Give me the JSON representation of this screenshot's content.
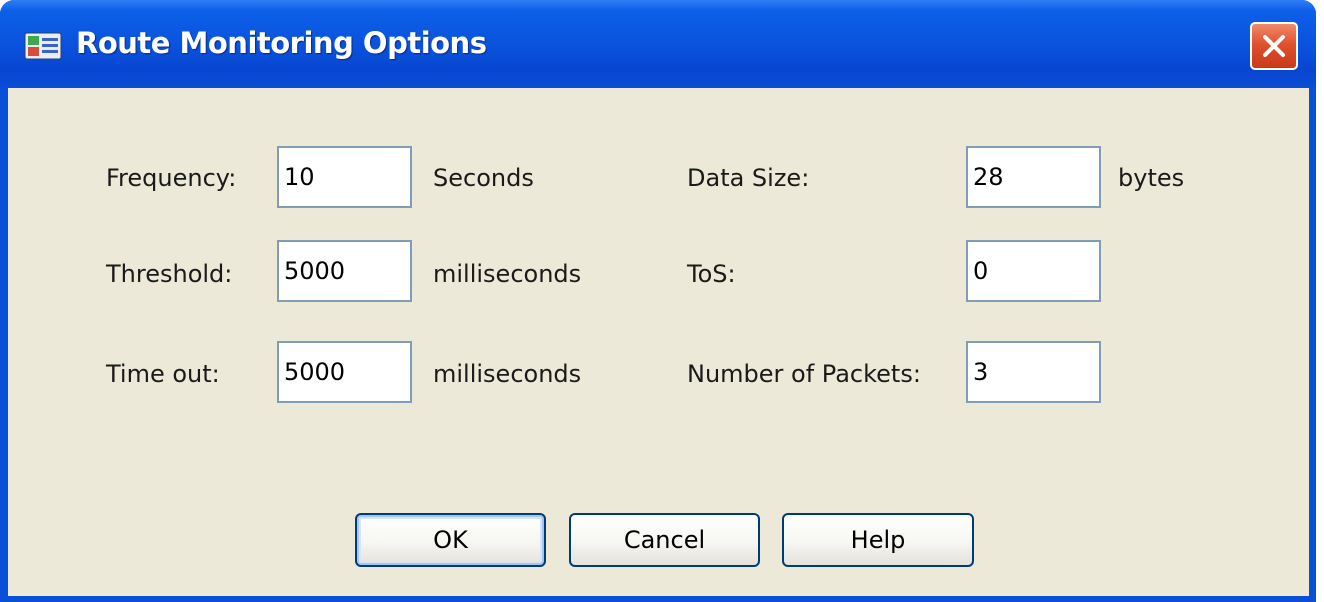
{
  "window": {
    "title": "Route Monitoring Options",
    "icon": "app-icon",
    "close_icon": "close-icon"
  },
  "fields": {
    "frequency": {
      "label": "Frequency:",
      "value": "10",
      "unit": "Seconds"
    },
    "threshold": {
      "label": "Threshold:",
      "value": "5000",
      "unit": "milliseconds"
    },
    "timeout": {
      "label": "Time out:",
      "value": "5000",
      "unit": "milliseconds"
    },
    "data_size": {
      "label": "Data Size:",
      "value": "28",
      "unit": "bytes"
    },
    "tos": {
      "label": "ToS:",
      "value": "0"
    },
    "num_packets": {
      "label": "Number of Packets:",
      "value": "3"
    }
  },
  "buttons": {
    "ok": "OK",
    "cancel": "Cancel",
    "help": "Help"
  },
  "colors": {
    "titlebar": "#0a55e0",
    "close_button": "#e0522e",
    "dialog_background": "#ece9d8",
    "input_border": "#7f9db9",
    "button_border": "#003c74"
  }
}
